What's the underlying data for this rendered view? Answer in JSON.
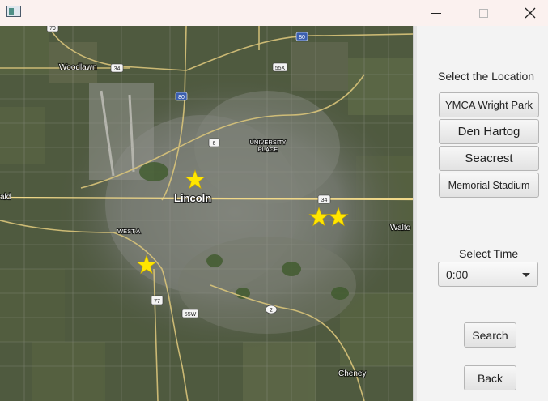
{
  "window": {
    "controls": {
      "minimize": "minimize",
      "maximize": "maximize",
      "close": "close"
    }
  },
  "map": {
    "labels": {
      "woodlawn": "Woodlawn",
      "lincoln": "Lincoln",
      "university_place_1": "UNIVERSITY",
      "university_place_2": "PLACE",
      "west_a": "WEST A",
      "cheney": "Cheney",
      "walton": "Walto",
      "ald": "ald"
    },
    "road_shields": {
      "r79": "79",
      "r80a": "80",
      "r80b": "80",
      "r34a": "34",
      "r34b": "34",
      "r55x": "55X",
      "r6": "6",
      "r77": "77",
      "r2": "2",
      "r55w": "55W"
    },
    "marker_color": "#ffe600"
  },
  "panel": {
    "location_heading": "Select the Location",
    "locations": [
      "YMCA Wright Park",
      "Den Hartog",
      "Seacrest",
      "Memorial Stadium"
    ],
    "time_heading": "Select Time",
    "time_value": "0:00",
    "search_label": "Search",
    "back_label": "Back"
  }
}
